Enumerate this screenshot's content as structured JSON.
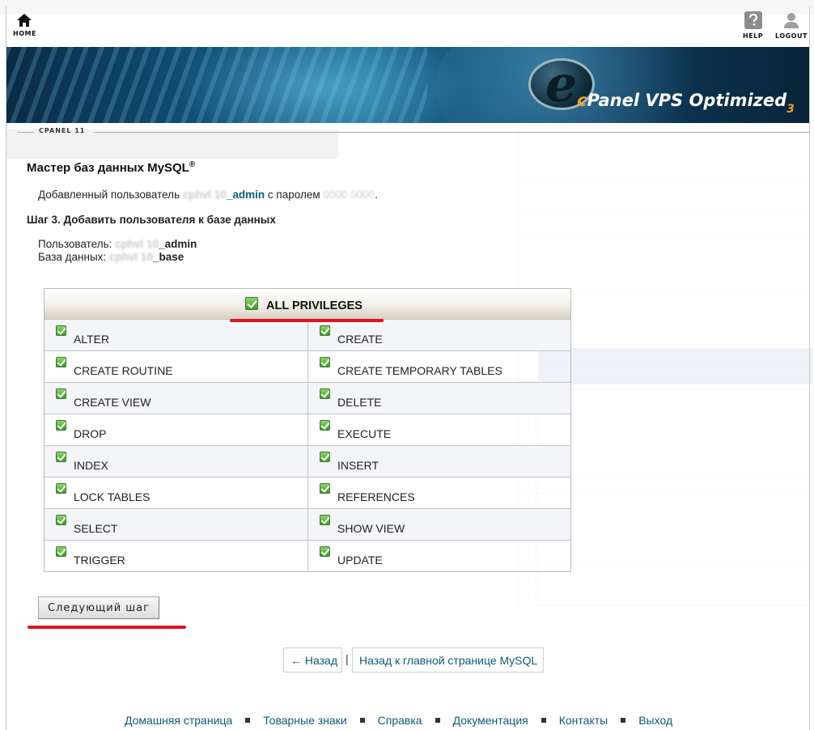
{
  "topbar": {
    "home_label": "HOME",
    "help_label": "HELP",
    "logout_label": "LOGOUT"
  },
  "banner": {
    "brand_c": "c",
    "brand_panel": "Panel",
    "brand_rest": " VPS Optimized",
    "brand_num": "3"
  },
  "version_label": "CPANEL 11",
  "page": {
    "title": "Мастер баз данных MySQL",
    "title_sup": "®",
    "added_prefix": "Добавленный пользователь",
    "added_user_hidden": " cphvl 10",
    "added_user_suffix": "_admin",
    "added_mid": " с паролем ",
    "added_password_hidden": "0000 0000",
    "added_end": ".",
    "step": "Шаг 3. Добавить пользователя к базе данных",
    "user_label": "Пользователь: ",
    "user_hidden": "cphvl 10",
    "user_suffix": "_admin",
    "db_label": "База данных: ",
    "db_hidden": "cphvl 10",
    "db_suffix": "_base"
  },
  "privileges": {
    "header": "ALL PRIVILEGES",
    "rows": [
      [
        "ALTER",
        "CREATE"
      ],
      [
        "CREATE ROUTINE",
        "CREATE TEMPORARY TABLES"
      ],
      [
        "CREATE VIEW",
        "DELETE"
      ],
      [
        "DROP",
        "EXECUTE"
      ],
      [
        "INDEX",
        "INSERT"
      ],
      [
        "LOCK TABLES",
        "REFERENCES"
      ],
      [
        "SELECT",
        "SHOW VIEW"
      ],
      [
        "TRIGGER",
        "UPDATE"
      ]
    ]
  },
  "next_button": "Следующий шаг",
  "nav": {
    "back": "← Назад",
    "separator": "|",
    "main": "Назад к главной странице MySQL"
  },
  "footer": [
    "Домашняя страница",
    "Товарные знаки",
    "Справка",
    "Документация",
    "Контакты",
    "Выход"
  ],
  "colors": {
    "link": "#0e5a78",
    "highlight": "#e0141e",
    "check": "#3f9a2b"
  }
}
